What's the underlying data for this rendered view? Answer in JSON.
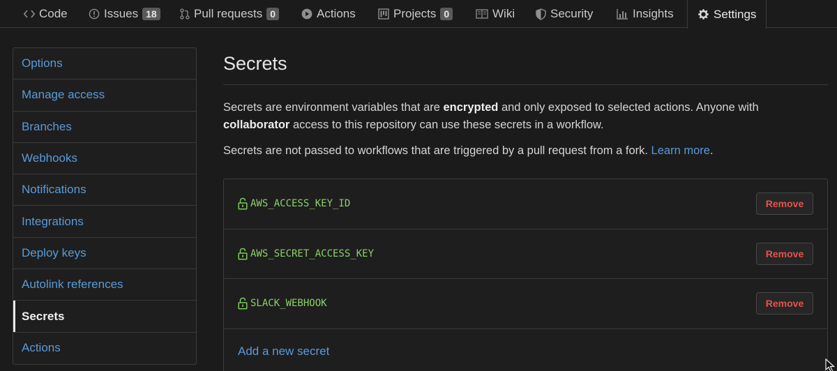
{
  "tabs": [
    {
      "label": "Code",
      "icon": "code-icon"
    },
    {
      "label": "Issues",
      "icon": "issue-opened-icon",
      "count": "18"
    },
    {
      "label": "Pull requests",
      "icon": "git-pull-request-icon",
      "count": "0"
    },
    {
      "label": "Actions",
      "icon": "play-icon"
    },
    {
      "label": "Projects",
      "icon": "project-icon",
      "count": "0"
    },
    {
      "label": "Wiki",
      "icon": "book-icon"
    },
    {
      "label": "Security",
      "icon": "shield-icon"
    },
    {
      "label": "Insights",
      "icon": "graph-icon"
    },
    {
      "label": "Settings",
      "icon": "gear-icon",
      "selected": true
    }
  ],
  "sidebar": {
    "items": [
      {
        "label": "Options"
      },
      {
        "label": "Manage access"
      },
      {
        "label": "Branches"
      },
      {
        "label": "Webhooks"
      },
      {
        "label": "Notifications"
      },
      {
        "label": "Integrations"
      },
      {
        "label": "Deploy keys"
      },
      {
        "label": "Autolink references"
      },
      {
        "label": "Secrets",
        "active": true
      },
      {
        "label": "Actions"
      }
    ]
  },
  "main": {
    "title": "Secrets",
    "desc": {
      "p1_a": "Secrets are environment variables that are ",
      "p1_b": "encrypted",
      "p1_c": " and only exposed to selected actions. Anyone with ",
      "p1_d": "collaborator",
      "p1_e": " access to this repository can use these secrets in a workflow.",
      "p2_a": "Secrets are not passed to workflows that are triggered by a pull request from a fork. ",
      "p2_link": "Learn more",
      "p2_end": "."
    },
    "secrets": [
      {
        "name": "AWS_ACCESS_KEY_ID",
        "action": "Remove"
      },
      {
        "name": "AWS_SECRET_ACCESS_KEY",
        "action": "Remove"
      },
      {
        "name": "SLACK_WEBHOOK",
        "action": "Remove"
      }
    ],
    "add_label": "Add a new secret"
  },
  "colors": {
    "background": "#1b1b1b",
    "link": "#5a9ad8",
    "secret_name": "#8bd06a",
    "remove": "#e5534b"
  }
}
